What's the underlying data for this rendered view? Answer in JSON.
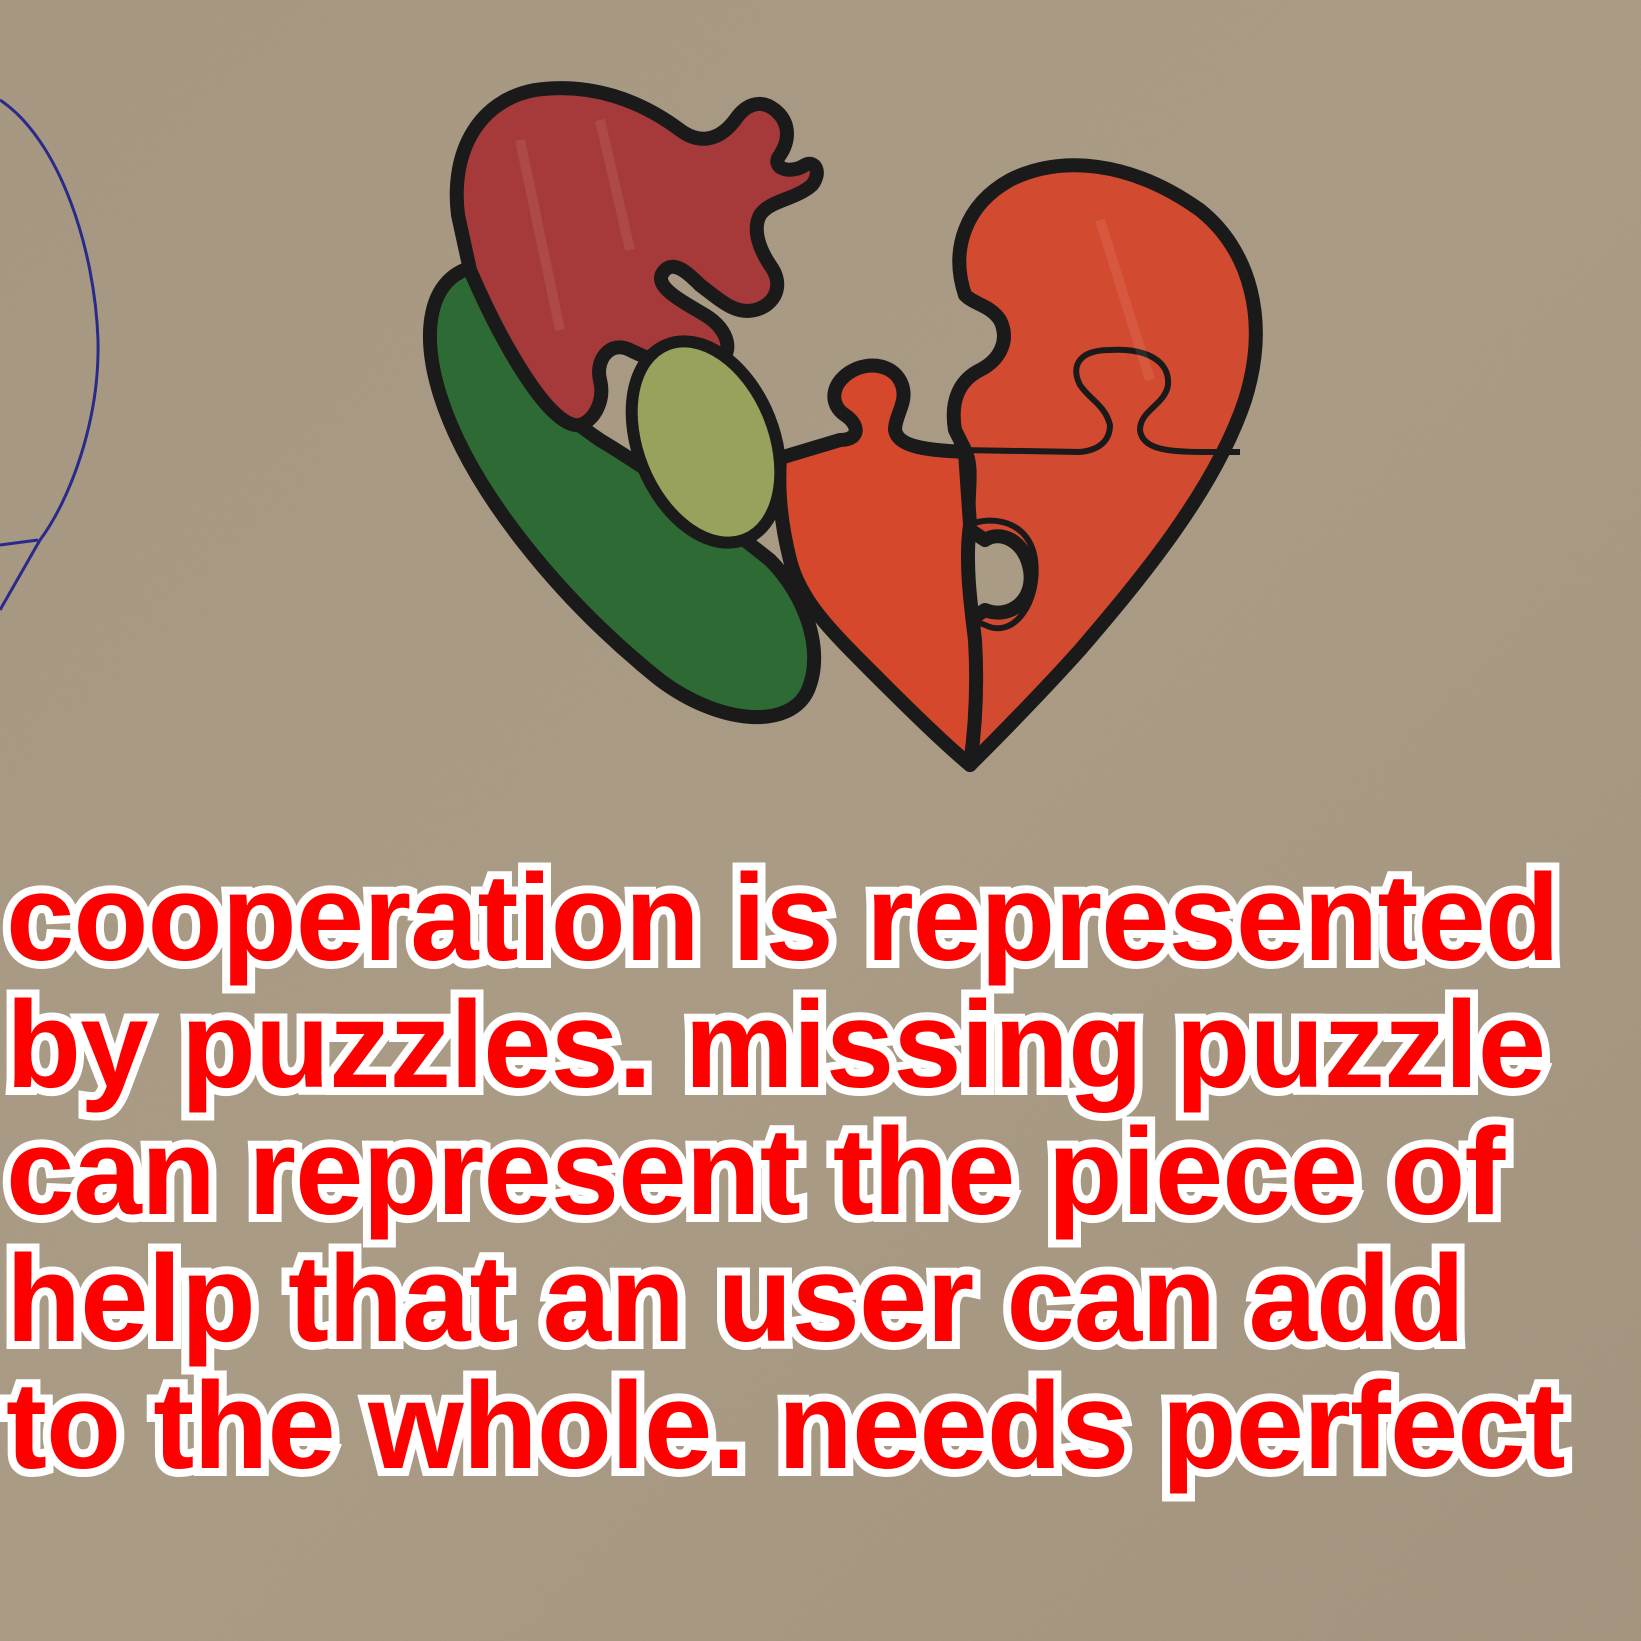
{
  "image": {
    "background_color": "#ab9c86",
    "caption_color": "#ff0000",
    "caption_outline_color": "#ffffff",
    "heart_colors": {
      "top_left_piece": "#a63a3a",
      "right_half": "#d24a2f",
      "lower_piece": "#d6482c",
      "green_shape": "#2e6b34",
      "light_green_oval": "#98a25c",
      "outline": "#1a1a1a"
    },
    "side_sketch_color": "#2a2a8a"
  },
  "caption": {
    "lines": [
      "cooperation is represented",
      "by puzzles. missing puzzle",
      "can represent the piece of",
      "help that an user can add",
      "to the whole. needs perfect"
    ]
  }
}
